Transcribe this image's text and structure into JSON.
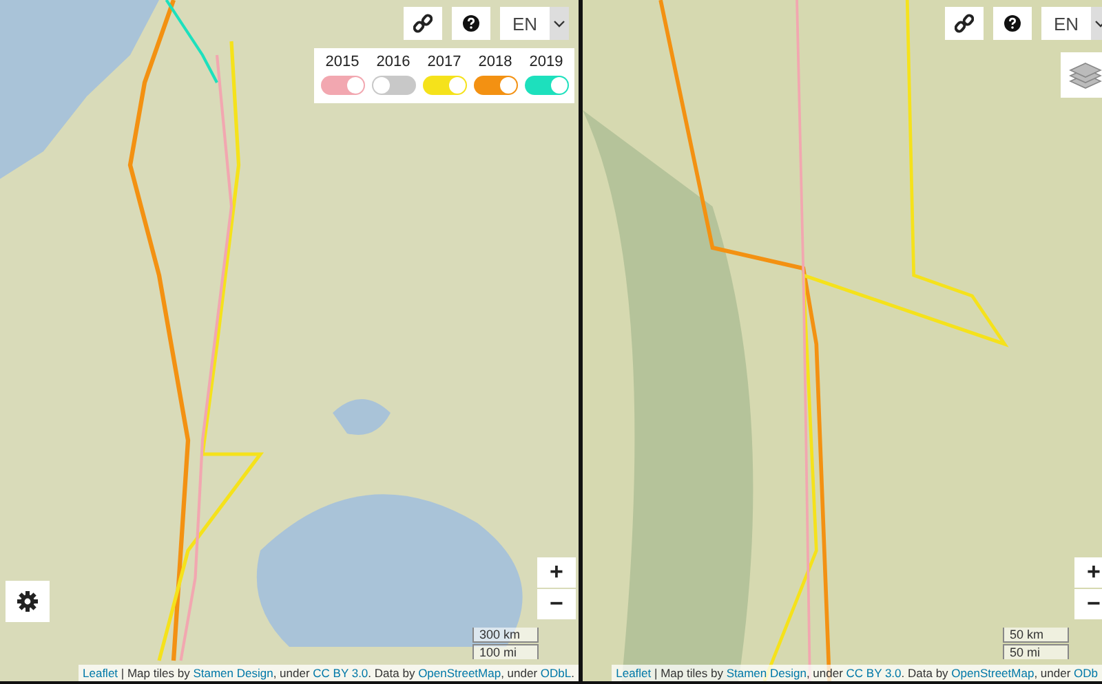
{
  "maps": [
    {
      "language": "EN",
      "layers_button": false,
      "settings_button": true,
      "year_toggles": [
        {
          "label": "2015",
          "on": true,
          "color": "#f2a7b0"
        },
        {
          "label": "2016",
          "on": false,
          "color": "#c8c8c8"
        },
        {
          "label": "2017",
          "on": true,
          "color": "#f5e21b"
        },
        {
          "label": "2018",
          "on": true,
          "color": "#f39112"
        },
        {
          "label": "2019",
          "on": true,
          "color": "#1de0bd"
        }
      ],
      "zoom": [
        "+",
        "−"
      ],
      "scale": [
        "300 km",
        "100 mi"
      ],
      "attribution": [
        {
          "text": "Leaflet",
          "link": true
        },
        {
          "text": " | Map tiles by ",
          "link": false
        },
        {
          "text": "Stamen Design",
          "link": true
        },
        {
          "text": ", under ",
          "link": false
        },
        {
          "text": "CC BY 3.0",
          "link": true
        },
        {
          "text": ". Data by ",
          "link": false
        },
        {
          "text": "OpenStreetMap",
          "link": true
        },
        {
          "text": ", under ",
          "link": false
        },
        {
          "text": "ODbL",
          "link": true
        },
        {
          "text": ".",
          "link": false
        }
      ]
    },
    {
      "language": "EN",
      "layers_button": true,
      "settings_button": false,
      "zoom": [
        "+",
        "−"
      ],
      "scale": [
        "50 km",
        "50 mi"
      ],
      "attribution": [
        {
          "text": "Leaflet",
          "link": true
        },
        {
          "text": " | Map tiles by ",
          "link": false
        },
        {
          "text": "Stamen Design",
          "link": true
        },
        {
          "text": ", under ",
          "link": false
        },
        {
          "text": "CC BY 3.0",
          "link": true
        },
        {
          "text": ". Data by ",
          "link": false
        },
        {
          "text": "OpenStreetMap",
          "link": true
        },
        {
          "text": ", under ",
          "link": false
        },
        {
          "text": "ODb",
          "link": true
        }
      ]
    }
  ]
}
